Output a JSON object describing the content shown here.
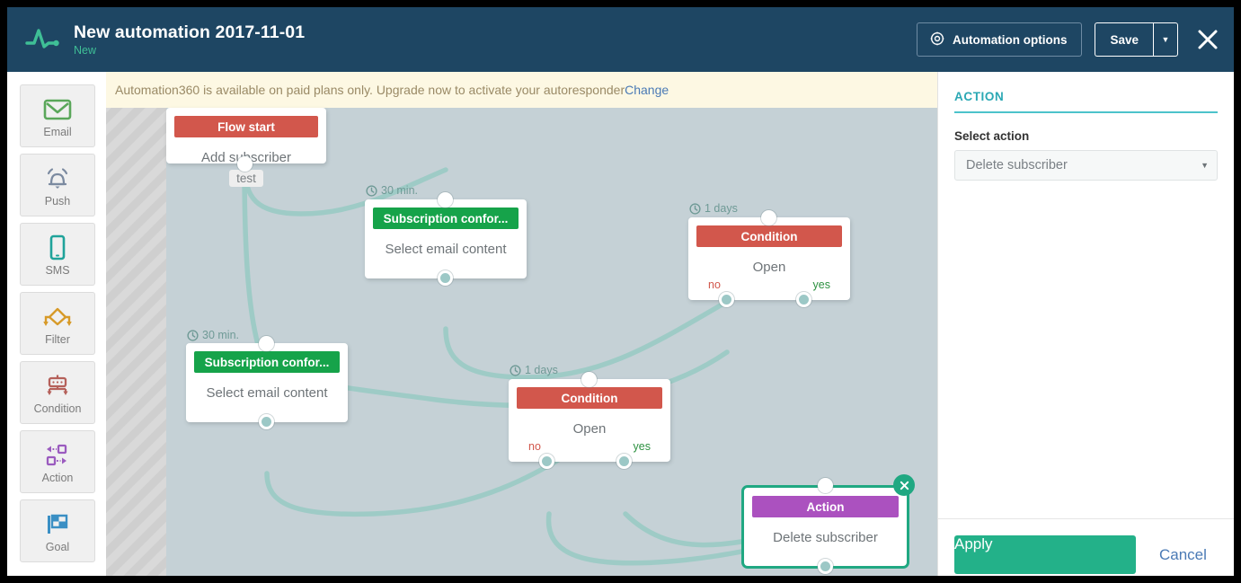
{
  "header": {
    "logo_icon": "pulse-logo-icon",
    "title": "New automation 2017-11-01",
    "subtitle": "New",
    "options_label": "Automation options",
    "options_icon": "gear-icon",
    "save_label": "Save",
    "caret_icon": "chevron-down-icon",
    "close_icon": "close-icon",
    "bg_color": "#1e4663",
    "accent_color": "#3fbf96"
  },
  "toolbar": {
    "items": [
      {
        "label": "Email",
        "icon": "envelope-icon",
        "color": "#5aa75a"
      },
      {
        "label": "Push",
        "icon": "bell-icon",
        "color": "#7b8aa0"
      },
      {
        "label": "SMS",
        "icon": "phone-icon",
        "color": "#1fa39a"
      },
      {
        "label": "Filter",
        "icon": "filter-icon",
        "color": "#d79a28"
      },
      {
        "label": "Condition",
        "icon": "condition-icon",
        "color": "#b5605a"
      },
      {
        "label": "Action",
        "icon": "action-icon",
        "color": "#9b5bbf"
      },
      {
        "label": "Goal",
        "icon": "flag-icon",
        "color": "#3a8fc4"
      }
    ]
  },
  "banner": {
    "text": "Automation360 is available on paid plans only. Upgrade now to activate your autoresponder ",
    "link_label": "Change",
    "bg_color": "#fdf8e3"
  },
  "canvas": {
    "nodes": [
      {
        "id": "flow-start",
        "header": "Flow start",
        "header_color": "#d2574c",
        "body": "Add subscriber",
        "pill": "test",
        "delay": null,
        "selected": false
      },
      {
        "id": "email-1",
        "header": "Subscription confor...",
        "header_color": "#16a34a",
        "body": "Select email content",
        "pill": null,
        "delay": "30 min.",
        "selected": false
      },
      {
        "id": "condition-1",
        "header": "Condition",
        "header_color": "#d2574c",
        "body": "Open",
        "branch_no": "no",
        "branch_yes": "yes",
        "delay": "1 days",
        "selected": false
      },
      {
        "id": "email-2",
        "header": "Subscription confor...",
        "header_color": "#16a34a",
        "body": "Select email content",
        "pill": null,
        "delay": "30 min.",
        "selected": false
      },
      {
        "id": "condition-2",
        "header": "Condition",
        "header_color": "#d2574c",
        "body": "Open",
        "branch_no": "no",
        "branch_yes": "yes",
        "delay": "1 days",
        "selected": false
      },
      {
        "id": "action-1",
        "header": "Action",
        "header_color": "#ab51bf",
        "body": "Delete subscriber",
        "pill": null,
        "delay": null,
        "selected": true,
        "delete_icon": "close-icon"
      }
    ],
    "clock_icon": "clock-icon",
    "wire_color": "#9ecbc6",
    "bg_color": "#c5d1d6"
  },
  "panel": {
    "title": "ACTION",
    "field_label": "Select action",
    "select_value": "Delete subscriber",
    "select_caret": "chevron-down-icon",
    "apply_label": "Apply",
    "cancel_label": "Cancel",
    "apply_color": "#23b189"
  }
}
